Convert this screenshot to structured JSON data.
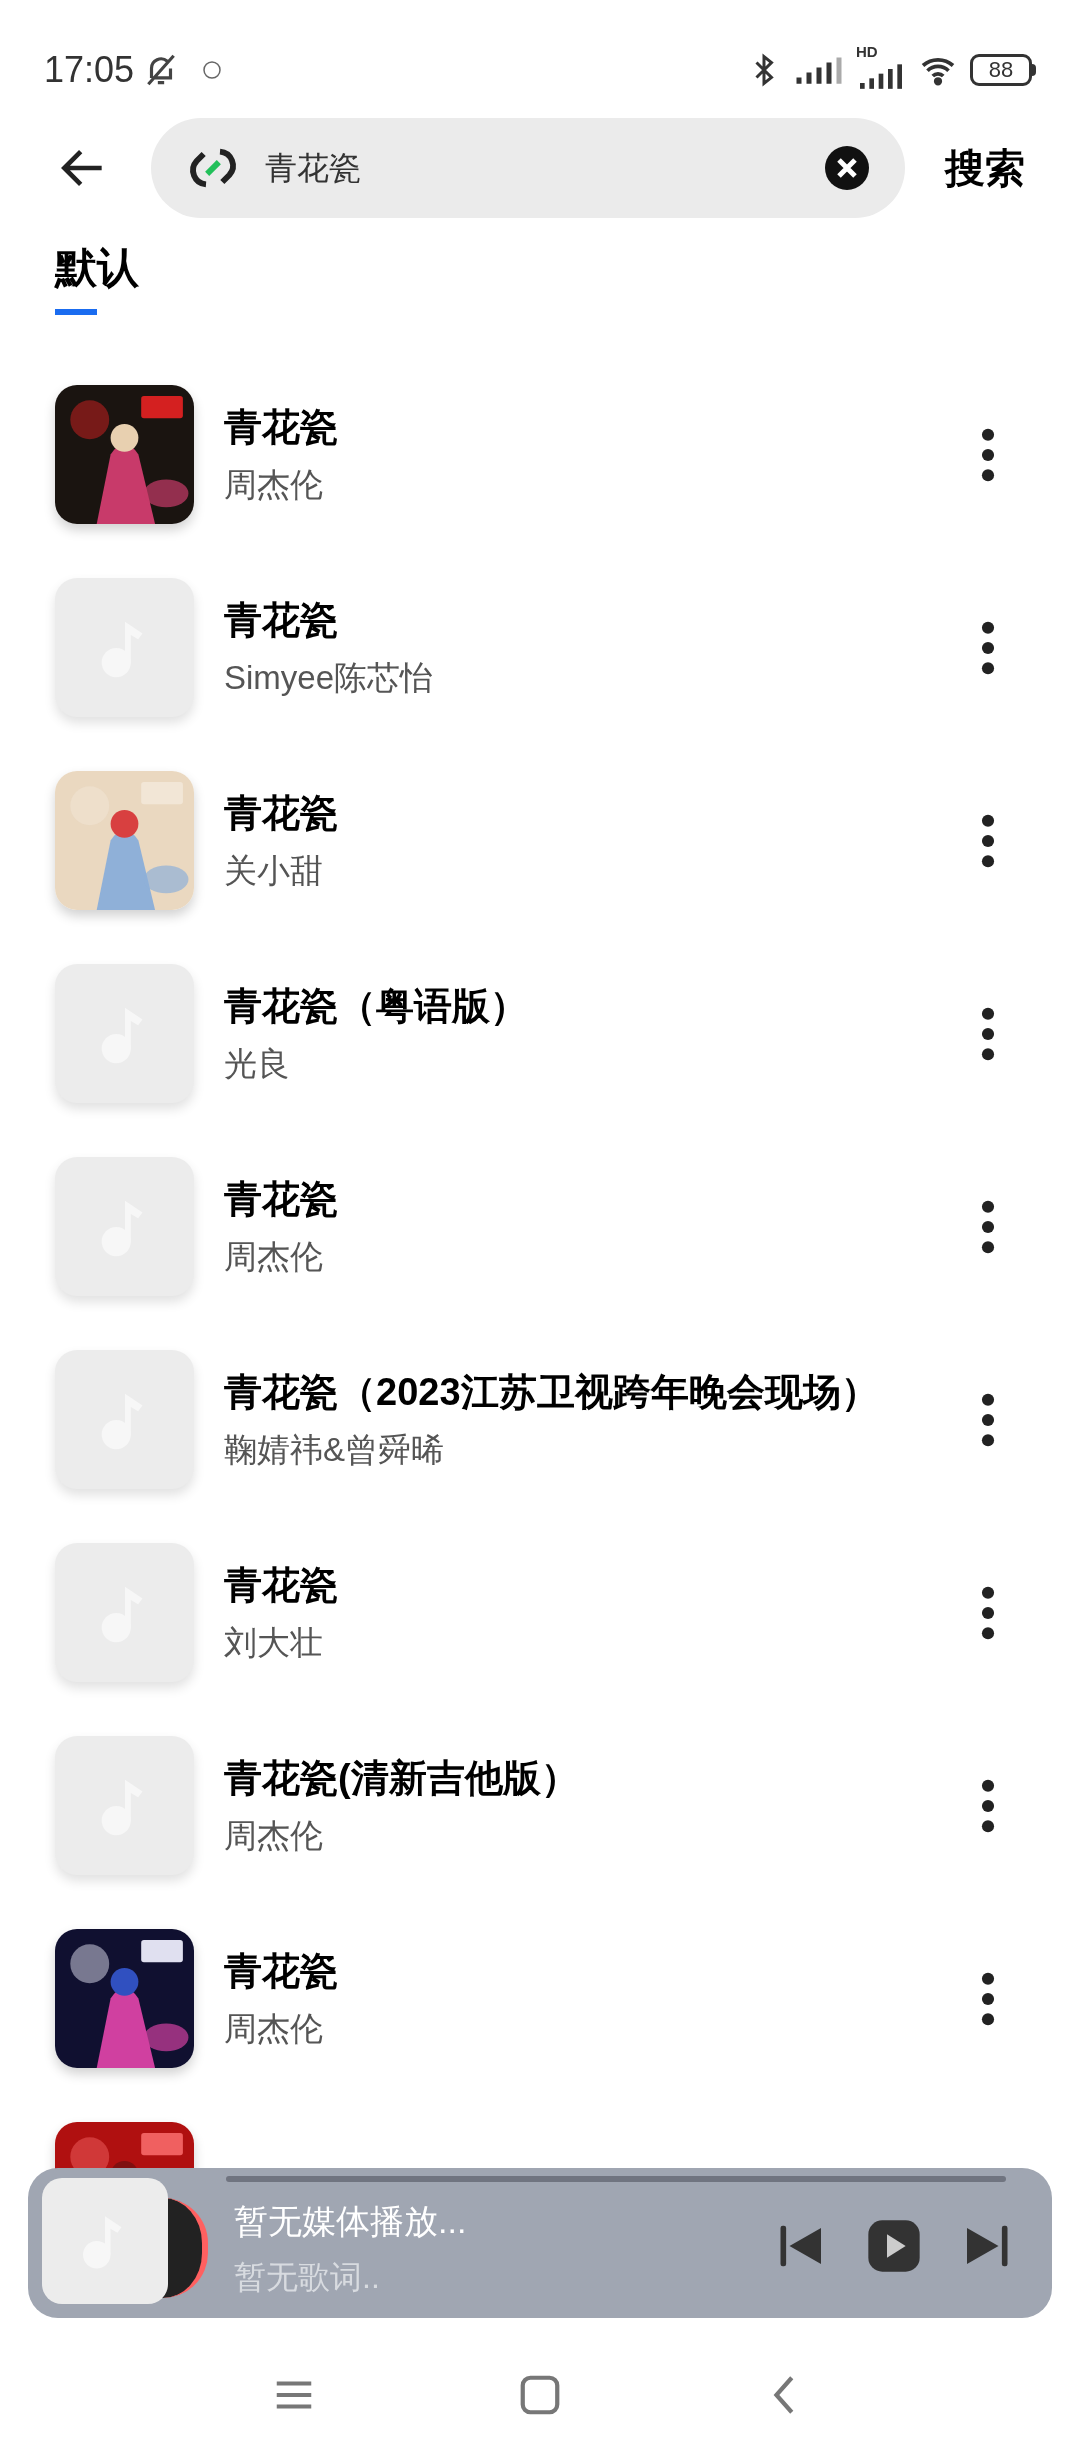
{
  "status_bar": {
    "time": "17:05",
    "battery": "88",
    "network_badge": "HD"
  },
  "search": {
    "value": "青花瓷",
    "button": "搜索"
  },
  "tabs": [
    {
      "label": "默认",
      "selected": true
    }
  ],
  "songs": [
    {
      "title": "青花瓷",
      "artist": "周杰伦",
      "kind": "picture"
    },
    {
      "title": "青花瓷",
      "artist": "Simyee陈芯怡",
      "kind": "placeholder"
    },
    {
      "title": "青花瓷",
      "artist": "关小甜",
      "kind": "picture"
    },
    {
      "title": "青花瓷（粤语版）",
      "artist": "光良",
      "kind": "placeholder"
    },
    {
      "title": "青花瓷",
      "artist": "周杰伦",
      "kind": "placeholder"
    },
    {
      "title": "青花瓷（2023江苏卫视跨年晚会现场）",
      "artist": "鞠婧祎&曾舜晞",
      "kind": "placeholder"
    },
    {
      "title": "青花瓷",
      "artist": "刘大壮",
      "kind": "placeholder"
    },
    {
      "title": "青花瓷(清新吉他版）",
      "artist": "周杰伦",
      "kind": "placeholder"
    },
    {
      "title": "青花瓷",
      "artist": "周杰伦",
      "kind": "picture"
    },
    {
      "kind": "picture"
    }
  ],
  "player": {
    "title": "暂无媒体播放...",
    "lyrics": "暂无歌词.."
  }
}
